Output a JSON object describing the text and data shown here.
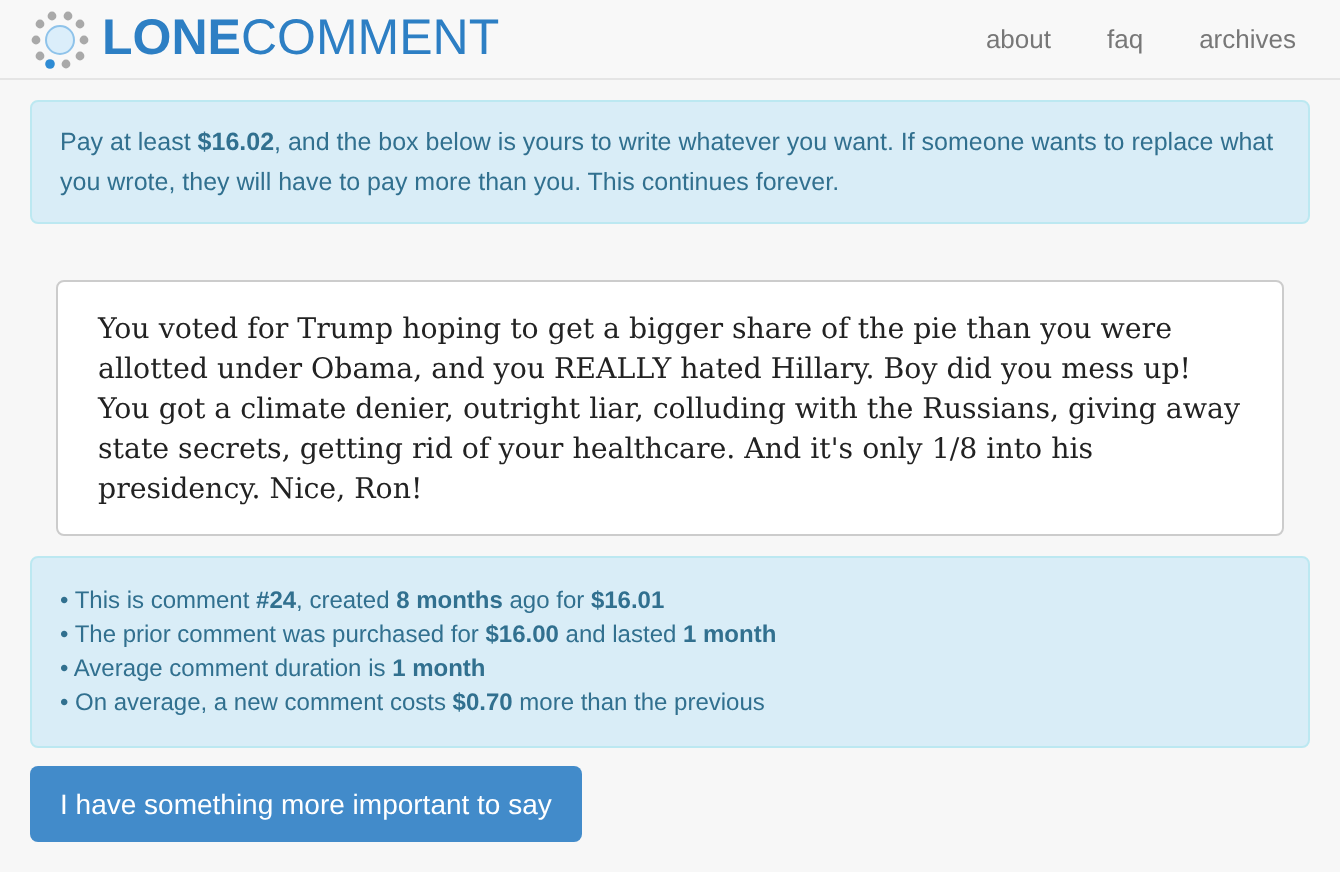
{
  "logo": {
    "bold": "LONE",
    "light": "COMMENT"
  },
  "nav": [
    {
      "label": "about"
    },
    {
      "label": "faq"
    },
    {
      "label": "archives"
    }
  ],
  "notice": "Pay at least **$16.02**, and the box below is yours to write whatever you want. If someone wants to replace what you wrote, they will have to pay more than you. This continues forever.",
  "comment": "You voted for Trump hoping to get a bigger share of the pie than you were allotted under Obama, and you REALLY hated Hillary. Boy did you mess up! You got a climate denier, outright liar, colluding with the Russians, giving away state secrets, getting rid of your healthcare. And it's only 1/8 into his presidency. Nice, Ron!",
  "stats": [
    "• This is comment **#24**, created **8 months** ago for **$16.01**",
    "• The prior comment was purchased for **$16.00** and lasted **1 month**",
    "• Average comment duration is **1 month**",
    "• On average, a new comment costs **$0.70** more than the previous"
  ],
  "button": "I have something more important to say"
}
